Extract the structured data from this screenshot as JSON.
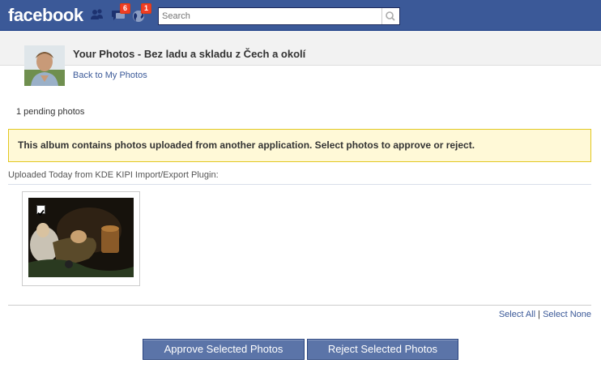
{
  "topbar": {
    "logo": "facebook",
    "friend_requests_count": "",
    "messages_count": "6",
    "notifications_count": "1",
    "search_placeholder": "Search"
  },
  "header": {
    "title": "Your Photos - Bez ladu a skladu z Čech a okolí",
    "back_link": "Back to My Photos"
  },
  "pending_text": "1 pending photos",
  "notice": "This album contains photos uploaded from another application. Select photos to approve or reject.",
  "uploaded_label": "Uploaded Today from KDE KIPI Import/Export Plugin:",
  "photos": [
    {
      "selected": true
    }
  ],
  "selection": {
    "select_all": "Select All",
    "separator": "|",
    "select_none": "Select None"
  },
  "buttons": {
    "approve": "Approve Selected Photos",
    "reject": "Reject Selected Photos"
  },
  "colors": {
    "brand": "#3b5998",
    "notice_bg": "#fff9d7",
    "notice_border": "#e2c822",
    "badge": "#f03d25",
    "button": "#5b74a8"
  }
}
